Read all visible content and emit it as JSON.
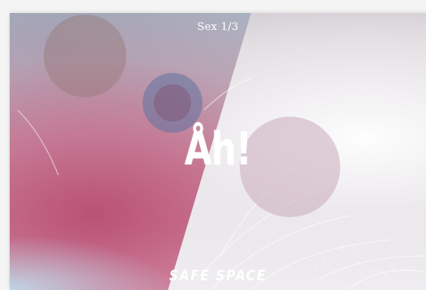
{
  "slide": {
    "counter": "Sex 1/3",
    "headline": "Åh!",
    "brand": "SAFE SPACE"
  },
  "colors": {
    "accent_pink": "#c86a8c",
    "circle_blue": "#5f73a0",
    "circle_mauve": "#c8aab9",
    "text": "#ffffff"
  }
}
